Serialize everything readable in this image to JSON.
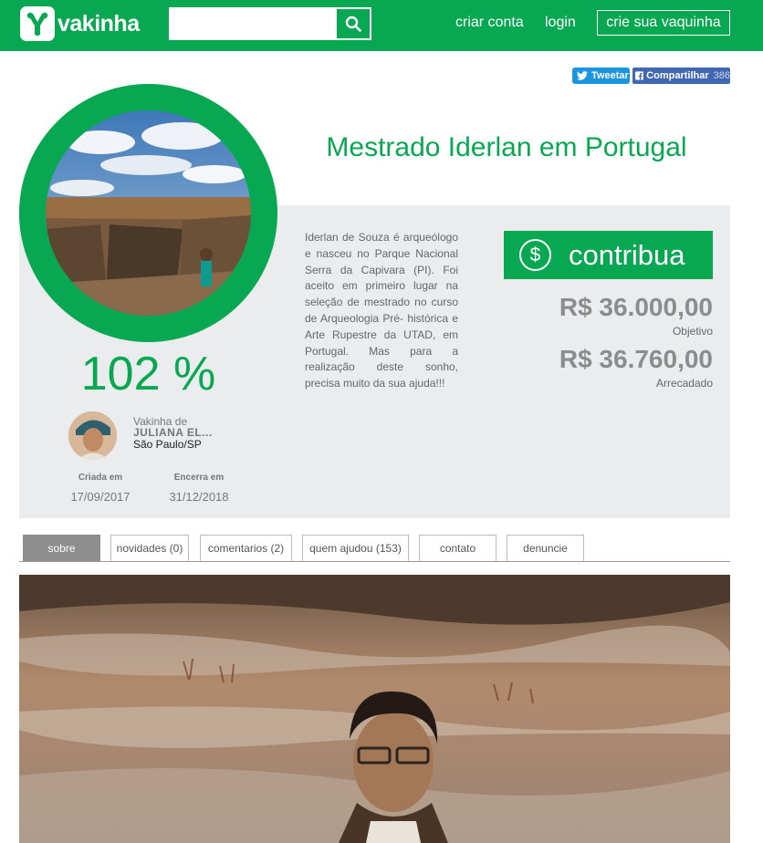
{
  "header": {
    "logo_text": "vakinha",
    "search_placeholder": "",
    "search_icon": "search-icon",
    "nav_create_account": "criar conta",
    "nav_login": "login",
    "nav_create_vaquinha": "crie sua vaquinha"
  },
  "share": {
    "tweet_label": "Tweetar",
    "facebook_label": "Compartilhar",
    "facebook_count": "386"
  },
  "campaign": {
    "title": "Mestrado Iderlan em Portugal",
    "percent": "102 %",
    "progress_fraction": 1.02,
    "description": "Iderlan de Souza é arqueólogo e nasceu no Parque Nacional Serra da Capivara (PI). Foi aceito em primeiro lugar na seleção de mestrado no curso de Arqueologia Pré- histórica e Arte Rupestre da UTAD, em Portugal. Mas para a realização deste sonho, precisa muito da sua ajuda!!!",
    "contribute_label": "contribua",
    "contribute_icon": "$",
    "goal_amount": "R$ 36.000,00",
    "goal_label": "Objetivo",
    "raised_amount": "R$ 36.760,00",
    "raised_label": "Arrecadado"
  },
  "owner": {
    "prefix": "Vakinha de",
    "name": "JULIANA EL...",
    "city": "São Paulo/SP"
  },
  "dates": {
    "created_label": "Criada em",
    "created_value": "17/09/2017",
    "ends_label": "Encerra em",
    "ends_value": "31/12/2018"
  },
  "tabs": [
    {
      "label": "sobre"
    },
    {
      "label": "novidades (0)"
    },
    {
      "label": "comentarios (2)"
    },
    {
      "label": "quem ajudou (153)"
    },
    {
      "label": "contato"
    },
    {
      "label": "denuncie"
    }
  ],
  "colors": {
    "brand_green": "#08a752",
    "panel_gray": "#ebeced",
    "amount_gray": "#8c8c8c",
    "twitter_blue": "#1b95e0",
    "facebook_blue": "#4267b2"
  }
}
